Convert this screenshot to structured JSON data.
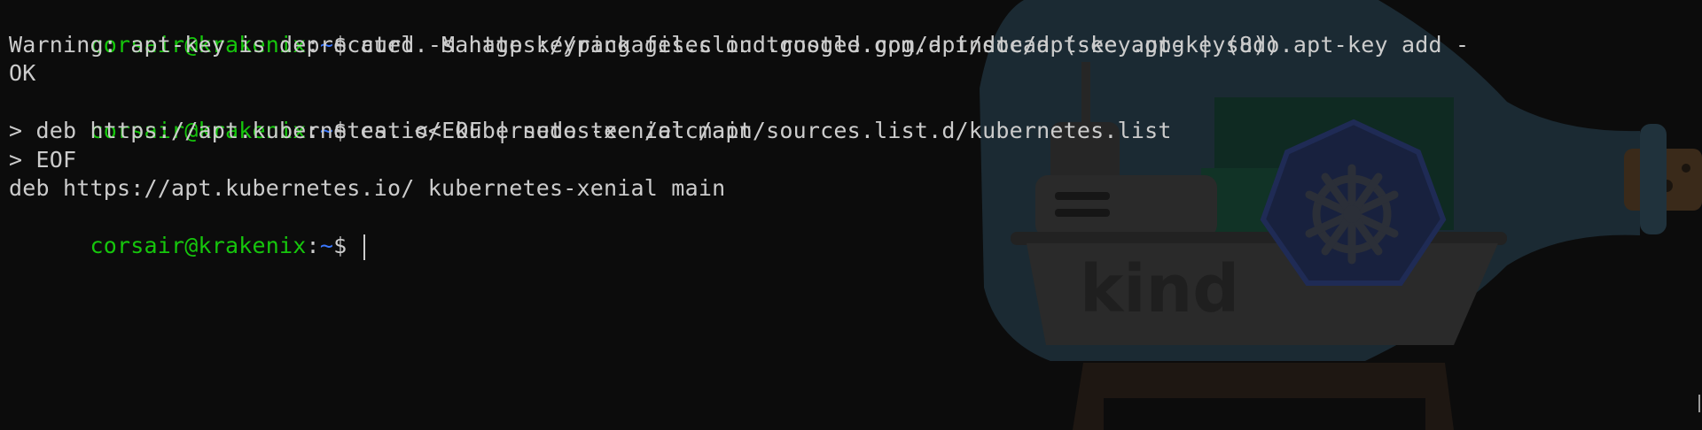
{
  "terminal": {
    "prompt": {
      "user_host": "corsair@krakenix",
      "separator": ":",
      "path": "~",
      "symbol": "$ "
    },
    "lines": [
      {
        "type": "prompt",
        "command": "curl -s https://packages.cloud.google.com/apt/doc/apt-key.gpg | sudo apt-key add -"
      },
      {
        "type": "output",
        "text": "Warning: apt-key is deprecated. Manage keyring files in trusted.gpg.d instead (see apt-key(8))."
      },
      {
        "type": "output",
        "text": "OK"
      },
      {
        "type": "prompt",
        "command": "cat <<EOF | sudo tee /etc/apt/sources.list.d/kubernetes.list"
      },
      {
        "type": "output",
        "text": "> deb https://apt.kubernetes.io/ kubernetes-xenial main"
      },
      {
        "type": "output",
        "text": "> EOF"
      },
      {
        "type": "output",
        "text": "deb https://apt.kubernetes.io/ kubernetes-xenial main"
      },
      {
        "type": "prompt",
        "command": ""
      }
    ],
    "background_logo_text": "kind"
  },
  "colors": {
    "background": "#0c0c0c",
    "text": "#cccccc",
    "user_host": "#16c60c",
    "path": "#3b78ff"
  }
}
